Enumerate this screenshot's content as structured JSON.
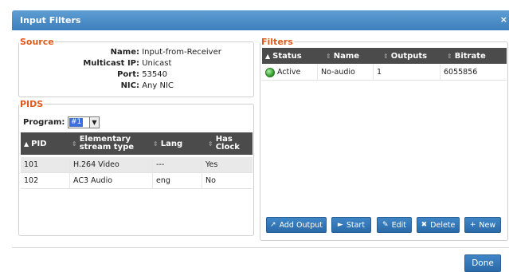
{
  "window": {
    "title": "Input Filters",
    "close_glyph": "×"
  },
  "source": {
    "legend": "Source",
    "fields": [
      {
        "label": "Name:",
        "value": "Input-from-Receiver"
      },
      {
        "label": "Multicast IP:",
        "value": "Unicast"
      },
      {
        "label": "Port:",
        "value": "53540"
      },
      {
        "label": "NIC:",
        "value": "Any NIC"
      }
    ]
  },
  "pids": {
    "legend": "PIDS",
    "program_label": "Program:",
    "program_value": "#1",
    "columns": [
      "PID",
      "Elementary stream type",
      "Lang",
      "Has Clock"
    ],
    "rows": [
      {
        "pid": "101",
        "type": "H.264 Video",
        "lang": "---",
        "clock": "Yes"
      },
      {
        "pid": "102",
        "type": "AC3 Audio",
        "lang": "eng",
        "clock": "No"
      }
    ]
  },
  "filters": {
    "legend": "Filters",
    "columns": [
      "Status",
      "Name",
      "Outputs",
      "Bitrate"
    ],
    "rows": [
      {
        "status": "Active",
        "name": "No-audio",
        "outputs": "1",
        "bitrate": "6055856",
        "status_icon": "green-dot-icon"
      }
    ],
    "buttons": [
      {
        "label": "Add Output",
        "icon": "↗"
      },
      {
        "label": "Start",
        "icon": "►"
      },
      {
        "label": "Edit",
        "icon": "✎"
      },
      {
        "label": "Delete",
        "icon": "✖"
      },
      {
        "label": "New",
        "icon": "+"
      }
    ]
  },
  "footer": {
    "done_label": "Done"
  },
  "colors": {
    "title_bar": "#4a8cc8",
    "legend": "#e05a1a",
    "header": "#4b4b4b",
    "button": "#3478b8"
  }
}
